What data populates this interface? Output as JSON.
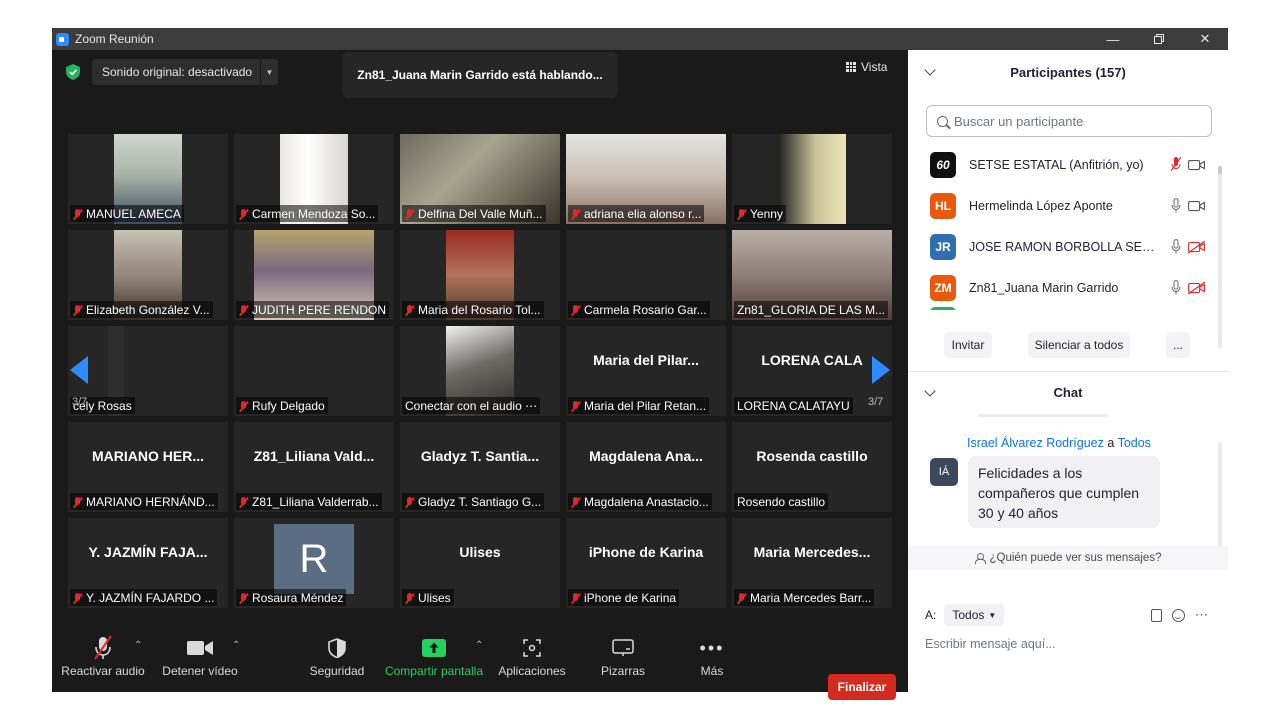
{
  "window": {
    "title": "Zoom Reunión"
  },
  "top_bar": {
    "sound_label": "Sonido original: desactivado",
    "talking_label": "Zn81_Juana Marin Garrido está hablando...",
    "view_label": "Vista"
  },
  "gallery": {
    "page_label": "3/7",
    "tiles": [
      {
        "label": "MANUEL AMECA",
        "big": "",
        "muted": true
      },
      {
        "label": "Carmen Mendoza So...",
        "big": "",
        "muted": true
      },
      {
        "label": "Delfina Del Valle Muñ...",
        "big": "",
        "muted": true
      },
      {
        "label": "adriana elia alonso r...",
        "big": "",
        "muted": true
      },
      {
        "label": "Yenny",
        "big": "",
        "muted": true
      },
      {
        "label": "Elizabeth González V...",
        "big": "",
        "muted": true
      },
      {
        "label": "JUDITH PERE RENDON",
        "big": "",
        "muted": true
      },
      {
        "label": "Maria del Rosario Tol...",
        "big": "",
        "muted": true
      },
      {
        "label": "Carmela Rosario Gar...",
        "big": "",
        "muted": true
      },
      {
        "label": "Zn81_GLORIA DE LAS M...",
        "big": "",
        "muted": false
      },
      {
        "label": "cely Rosas",
        "big": "",
        "muted": false
      },
      {
        "label": "Rufy Delgado",
        "big": "",
        "muted": true
      },
      {
        "label": "Conectar con el audio ⋯",
        "big": "",
        "muted": false
      },
      {
        "label": "Maria del Pilar Retan...",
        "big": "Maria del Pilar...",
        "muted": true
      },
      {
        "label": "LORENA CALATAYU",
        "big": "LORENA CALA",
        "muted": false
      },
      {
        "label": "MARIANO HERNÁND...",
        "big": "MARIANO HER...",
        "muted": true
      },
      {
        "label": "Z81_Liliana Valderrab...",
        "big": "Z81_Liliana Vald...",
        "muted": true
      },
      {
        "label": "Gladyz T. Santiago G...",
        "big": "Gladyz T. Santia...",
        "muted": true
      },
      {
        "label": "Magdalena Anastacio...",
        "big": "Magdalena Ana...",
        "muted": true
      },
      {
        "label": "Rosendo castillo",
        "big": "Rosenda castillo",
        "muted": false
      },
      {
        "label": "Y. JAZMÍN FAJARDO ...",
        "big": "Y. JAZMÍN FAJA...",
        "muted": true
      },
      {
        "label": "Rosaura Méndez",
        "big": "",
        "muted": true,
        "avatar_letter": "R"
      },
      {
        "label": "Ulises",
        "big": "Ulises",
        "muted": true
      },
      {
        "label": "iPhone de Karina",
        "big": "iPhone de Karina",
        "muted": true
      },
      {
        "label": "Maria Mercedes Barr...",
        "big": "Maria Mercedes...",
        "muted": true
      }
    ]
  },
  "toolbar": {
    "unmute": "Reactivar audio",
    "stop_video": "Detener vídeo",
    "security": "Seguridad",
    "share": "Compartir pantalla",
    "apps": "Aplicaciones",
    "whiteboards": "Pizarras",
    "more": "Más",
    "end": "Finalizar"
  },
  "participants": {
    "title": "Participantes (157)",
    "search_placeholder": "Buscar un participante",
    "list": [
      {
        "initials": "60",
        "name": "SETSE ESTATAL (Anfitrión, yo)",
        "color": "#1a1a1a"
      },
      {
        "initials": "HL",
        "name": "Hermelinda López Aponte",
        "color": "#e8590c"
      },
      {
        "initials": "JR",
        "name": "JOSE RAMON BORBOLLA SEG...",
        "color": "#2f6fb0"
      },
      {
        "initials": "ZM",
        "name": "Zn81_Juana Marin Garrido",
        "color": "#e8590c"
      }
    ],
    "invite": "Invitar",
    "mute_all": "Silenciar a todos",
    "more": "..."
  },
  "chat": {
    "title": "Chat",
    "sender": "Israel Álvarez Rodríguez",
    "to_word": "a",
    "recipient": "Todos",
    "sender_initials": "IÁ",
    "message": "Felicidades a los compañeros que cumplen 30 y 40 años",
    "who_can_see": "¿Quién puede ver sus mensajes?",
    "to_label": "A:",
    "to_value": "Todos",
    "input_placeholder": "Escribir mensaje aquí..."
  }
}
